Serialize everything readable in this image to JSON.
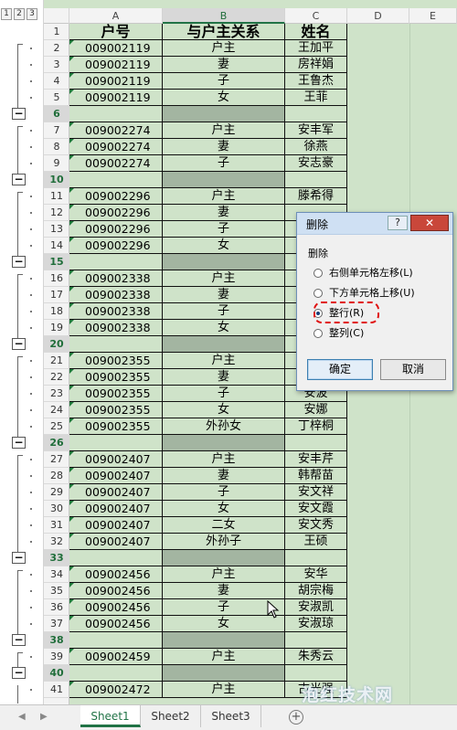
{
  "outline": {
    "levels": [
      "1",
      "2",
      "3"
    ],
    "collapse_symbol": "−"
  },
  "columns": [
    "A",
    "B",
    "C",
    "D",
    "E"
  ],
  "sheet": {
    "header": {
      "row": "1",
      "a": "户号",
      "b": "与户主关系",
      "c": "姓名"
    },
    "rows": [
      {
        "row": "2",
        "a": "009002119",
        "b": "户主",
        "c": "王加平"
      },
      {
        "row": "3",
        "a": "009002119",
        "b": "妻",
        "c": "房祥娟"
      },
      {
        "row": "4",
        "a": "009002119",
        "b": "子",
        "c": "王鲁杰"
      },
      {
        "row": "5",
        "a": "009002119",
        "b": "女",
        "c": "王菲"
      },
      {
        "row": "6",
        "a": "",
        "b": "",
        "c": "",
        "subtotal": true
      },
      {
        "row": "7",
        "a": "009002274",
        "b": "户主",
        "c": "安丰军"
      },
      {
        "row": "8",
        "a": "009002274",
        "b": "妻",
        "c": "徐燕"
      },
      {
        "row": "9",
        "a": "009002274",
        "b": "子",
        "c": "安志豪"
      },
      {
        "row": "10",
        "a": "",
        "b": "",
        "c": "",
        "subtotal": true
      },
      {
        "row": "11",
        "a": "009002296",
        "b": "户主",
        "c": "滕希得"
      },
      {
        "row": "12",
        "a": "009002296",
        "b": "妻",
        "c": ""
      },
      {
        "row": "13",
        "a": "009002296",
        "b": "子",
        "c": ""
      },
      {
        "row": "14",
        "a": "009002296",
        "b": "女",
        "c": ""
      },
      {
        "row": "15",
        "a": "",
        "b": "",
        "c": "",
        "subtotal": true
      },
      {
        "row": "16",
        "a": "009002338",
        "b": "户主",
        "c": ""
      },
      {
        "row": "17",
        "a": "009002338",
        "b": "妻",
        "c": ""
      },
      {
        "row": "18",
        "a": "009002338",
        "b": "子",
        "c": ""
      },
      {
        "row": "19",
        "a": "009002338",
        "b": "女",
        "c": ""
      },
      {
        "row": "20",
        "a": "",
        "b": "",
        "c": "",
        "subtotal": true
      },
      {
        "row": "21",
        "a": "009002355",
        "b": "户主",
        "c": ""
      },
      {
        "row": "22",
        "a": "009002355",
        "b": "妻",
        "c": ""
      },
      {
        "row": "23",
        "a": "009002355",
        "b": "子",
        "c": "安波"
      },
      {
        "row": "24",
        "a": "009002355",
        "b": "女",
        "c": "安娜"
      },
      {
        "row": "25",
        "a": "009002355",
        "b": "外孙女",
        "c": "丁梓桐"
      },
      {
        "row": "26",
        "a": "",
        "b": "",
        "c": "",
        "subtotal": true
      },
      {
        "row": "27",
        "a": "009002407",
        "b": "户主",
        "c": "安丰芹"
      },
      {
        "row": "28",
        "a": "009002407",
        "b": "妻",
        "c": "韩帮苗"
      },
      {
        "row": "29",
        "a": "009002407",
        "b": "子",
        "c": "安文祥"
      },
      {
        "row": "30",
        "a": "009002407",
        "b": "女",
        "c": "安文霞"
      },
      {
        "row": "31",
        "a": "009002407",
        "b": "二女",
        "c": "安文秀"
      },
      {
        "row": "32",
        "a": "009002407",
        "b": "外孙子",
        "c": "王硕"
      },
      {
        "row": "33",
        "a": "",
        "b": "",
        "c": "",
        "subtotal": true
      },
      {
        "row": "34",
        "a": "009002456",
        "b": "户主",
        "c": "安华"
      },
      {
        "row": "35",
        "a": "009002456",
        "b": "妻",
        "c": "胡宗梅"
      },
      {
        "row": "36",
        "a": "009002456",
        "b": "子",
        "c": "安淑凯"
      },
      {
        "row": "37",
        "a": "009002456",
        "b": "女",
        "c": "安淑琼"
      },
      {
        "row": "38",
        "a": "",
        "b": "",
        "c": "",
        "subtotal": true
      },
      {
        "row": "39",
        "a": "009002459",
        "b": "户主",
        "c": "朱秀云"
      },
      {
        "row": "40",
        "a": "",
        "b": "",
        "c": "",
        "subtotal": true
      },
      {
        "row": "41",
        "a": "009002472",
        "b": "户主",
        "c": "古光强"
      }
    ]
  },
  "dialog": {
    "title": "删除",
    "help": "?",
    "close": "✕",
    "group_label": "删除",
    "options": [
      {
        "label": "右侧单元格左移(L)",
        "selected": false
      },
      {
        "label": "下方单元格上移(U)",
        "selected": false
      },
      {
        "label": "整行(R)",
        "selected": true
      },
      {
        "label": "整列(C)",
        "selected": false
      }
    ],
    "ok": "确定",
    "cancel": "取消"
  },
  "tabs": {
    "prev": "◀",
    "next": "▶",
    "sheets": [
      "Sheet1",
      "Sheet2",
      "Sheet3"
    ],
    "active": "Sheet1",
    "add": "+"
  },
  "watermark": "泡红技术网",
  "colors": {
    "grid_bg": "#cfe3c9",
    "subtotal_fill": "#a3b5a1",
    "excel_green": "#217346",
    "highlight": "#e01010"
  }
}
